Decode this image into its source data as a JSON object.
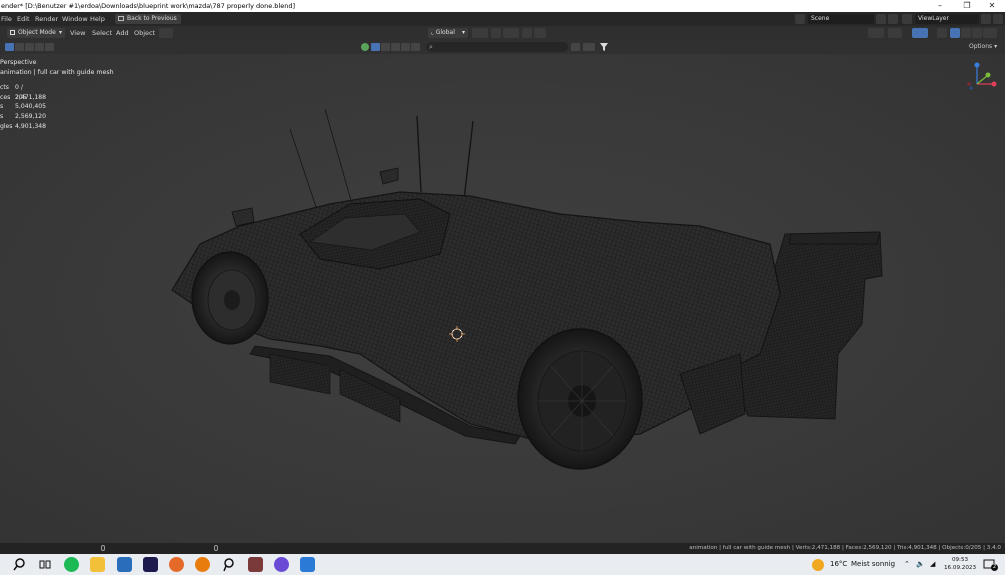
{
  "window": {
    "title": "ender* [D:\\Benutzer #1\\erdoa\\Downloads\\blueprint work\\mazda\\787 properly done.blend]",
    "minimize_glyph": "–",
    "maximize_glyph": "❐",
    "close_glyph": "✕"
  },
  "menubar": {
    "items": [
      "File",
      "Edit",
      "Render",
      "Window",
      "Help"
    ],
    "back_button": "Back to Previous",
    "scene_label": "Scene",
    "viewlayer_label": "ViewLayer"
  },
  "viewport_header": {
    "mode": "Object Mode",
    "menus": [
      "View",
      "Select",
      "Add",
      "Object"
    ],
    "transform_orientation": "Global"
  },
  "toolrow": {
    "options_label": "Options"
  },
  "viewport": {
    "view_name": "Perspective",
    "collection_path": "animation | full car with guide mesh",
    "stats": [
      {
        "key": "cts",
        "value": "0 / 205"
      },
      {
        "key": "ces",
        "value": "2,471,188"
      },
      {
        "key": "s",
        "value": "5,040,405"
      },
      {
        "key": "s",
        "value": "2,569,120"
      },
      {
        "key": "gles",
        "value": "4,901,348"
      }
    ],
    "gizmo_axes": [
      "X",
      "Y",
      "Z"
    ]
  },
  "statusbar": {
    "text": "animation | full car with guide mesh | Verts:2,471,188 | Faces:2,569,120 | Tris:4,901,348 | Objects:0/205 | 3.4.0"
  },
  "taskbar": {
    "temperature": "16°C",
    "weather": "Meist sonnig",
    "time": "09:53",
    "date": "16.09.2023",
    "notification_count": "2"
  },
  "colors": {
    "accent": "#4772b3",
    "title_bg": "#ffffff",
    "menubar_bg": "#272727",
    "viewport_bg": "#3a3a3a",
    "taskbar_bg": "#e9edf2"
  }
}
